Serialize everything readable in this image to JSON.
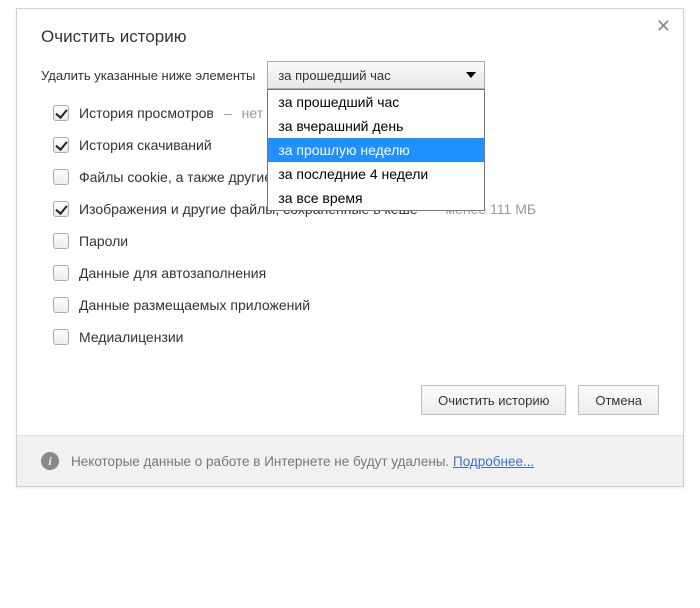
{
  "dialog": {
    "title": "Очистить историю",
    "close_glyph": "✕"
  },
  "top": {
    "label": "Удалить указанные ниже элементы",
    "selected": "за прошедший час",
    "options": [
      {
        "label": "за прошедший час"
      },
      {
        "label": "за вчерашний день"
      },
      {
        "label": "за прошлую неделю",
        "highlighted": true
      },
      {
        "label": "за последние 4 недели"
      },
      {
        "label": "за все время"
      }
    ]
  },
  "items": [
    {
      "label": "История просмотров",
      "checked": true,
      "hint_sep": " –  ",
      "hint": "нет"
    },
    {
      "label": "История скачиваний",
      "checked": true
    },
    {
      "label": "Файлы cookie, а также другие данные сайтов и плагинов",
      "checked": false
    },
    {
      "label": "Изображения и другие файлы, сохраненные в кеше",
      "checked": true,
      "hint_sep": " –  ",
      "hint": "менее 111 МБ"
    },
    {
      "label": "Пароли",
      "checked": false
    },
    {
      "label": "Данные для автозаполнения",
      "checked": false
    },
    {
      "label": "Данные размещаемых приложений",
      "checked": false
    },
    {
      "label": "Медиалицензии",
      "checked": false
    }
  ],
  "buttons": {
    "clear": "Очистить историю",
    "cancel": "Отмена"
  },
  "footer": {
    "info_glyph": "i",
    "text": "Некоторые данные о работе в Интернете не будут удалены. ",
    "link": "Подробнее..."
  }
}
